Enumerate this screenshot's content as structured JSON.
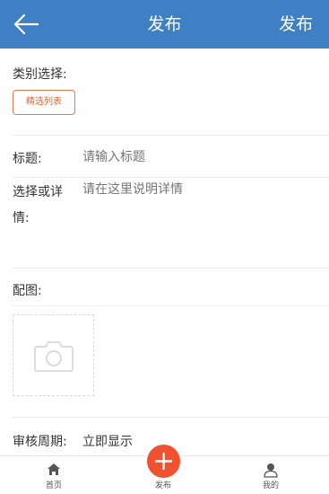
{
  "header": {
    "title": "发布",
    "publish_label": "发布"
  },
  "category": {
    "label": "类别选择:",
    "selected": "精选列表"
  },
  "title_field": {
    "label": "标题:",
    "placeholder": "请输入标题"
  },
  "detail_field": {
    "label_line1": "选择或详",
    "label_line2": "情:",
    "placeholder": "请在这里说明详情"
  },
  "image_field": {
    "label": "配图:",
    "icon": "camera-icon"
  },
  "review": {
    "label": "审核周期:",
    "value": "立即显示"
  },
  "tabbar": {
    "home_label": "首页",
    "post_label": "发布",
    "mine_label": "我的"
  },
  "colors": {
    "header_bg": "#3f7fc4",
    "accent": "#f0512f",
    "tag_border": "#e07c52"
  }
}
